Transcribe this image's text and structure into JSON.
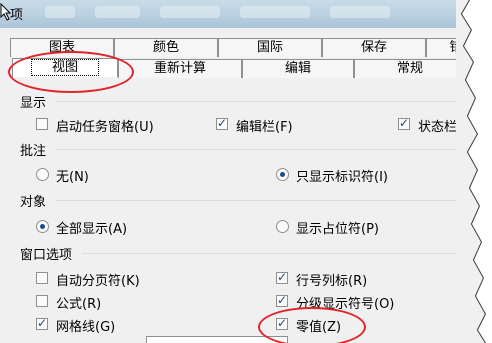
{
  "title": "选项",
  "title_fragment": "项",
  "tabs_row1": [
    "图表",
    "颜色",
    "国际",
    "保存",
    "错"
  ],
  "tabs_row2": [
    "视图",
    "重新计算",
    "编辑",
    "常规"
  ],
  "selected_tab": "视图",
  "sections": {
    "show": {
      "label": "显示",
      "items": [
        {
          "label": "启动任务窗格(U)",
          "checked": false
        },
        {
          "label": "编辑栏(F)",
          "checked": true
        },
        {
          "label": "状态栏",
          "checked": true
        }
      ]
    },
    "comments": {
      "label": "批注",
      "items": [
        {
          "label": "无(N)",
          "selected": false
        },
        {
          "label": "只显示标识符(I)",
          "selected": true
        }
      ]
    },
    "objects": {
      "label": "对象",
      "items": [
        {
          "label": "全部显示(A)",
          "selected": true
        },
        {
          "label": "显示占位符(P)",
          "selected": false
        }
      ]
    },
    "window": {
      "label": "窗口选项",
      "items": [
        {
          "label": "自动分页符(K)",
          "checked": false
        },
        {
          "label": "行号列标(R)",
          "checked": true
        },
        {
          "label": "公式(R)",
          "checked": false
        },
        {
          "label": "分级显示符号(O)",
          "checked": true
        },
        {
          "label": "网格线(G)",
          "checked": true
        },
        {
          "label": "零值(Z)",
          "checked": true
        }
      ]
    }
  },
  "colors": {
    "annotation": "#e0242a",
    "titlebar": "#b8cfe0",
    "dialog": "#f0f0f0"
  },
  "icons": [
    "app-icon",
    "checkbox",
    "radio-button",
    "red-annotation-ellipse"
  ]
}
